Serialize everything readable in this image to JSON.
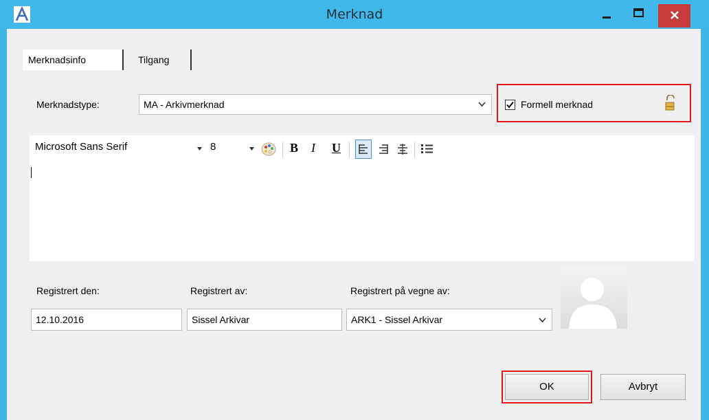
{
  "window": {
    "title": "Merknad"
  },
  "tabs": [
    {
      "label": "Merknadsinfo",
      "active": true
    },
    {
      "label": "Tilgang",
      "active": false
    }
  ],
  "type_field": {
    "label": "Merknadstype:",
    "value": "MA - Arkivmerknad"
  },
  "formal": {
    "label": "Formell merknad",
    "checked": true,
    "icon": "lock-icon"
  },
  "toolbar": {
    "font": "Microsoft Sans Serif",
    "size": "8",
    "bold": "B",
    "italic": "I",
    "underline": "U"
  },
  "fields": {
    "registered_date": {
      "label": "Registrert den:",
      "value": "12.10.2016"
    },
    "registered_by": {
      "label": "Registrert av:",
      "value": "Sissel Arkivar"
    },
    "on_behalf": {
      "label": "Registrert på vegne av:",
      "value": "ARK1 - Sissel Arkivar"
    }
  },
  "buttons": {
    "ok": "OK",
    "cancel": "Avbryt"
  },
  "colors": {
    "titlebar": "#40b8ea",
    "close": "#c83b3b",
    "highlight": "#e4141b"
  }
}
